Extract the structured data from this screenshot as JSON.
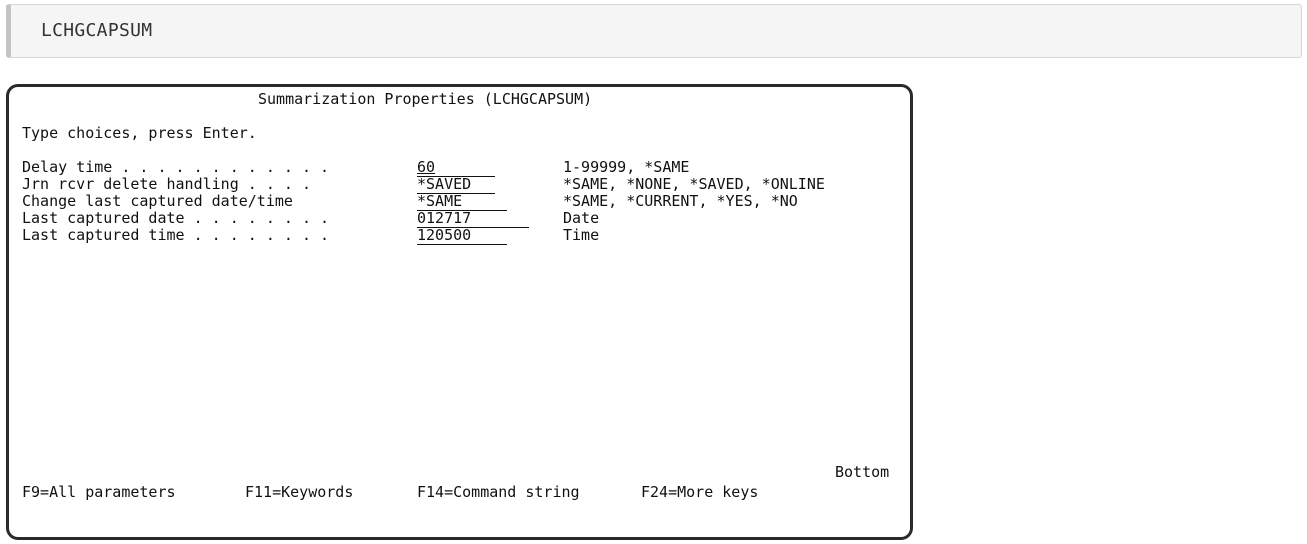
{
  "command_bar": {
    "text": "LCHGCAPSUM"
  },
  "screen": {
    "title": "Summarization Properties (LCHGCAPSUM)",
    "instruction": "Type choices, press Enter.",
    "rows": [
      {
        "label": "Delay time . . . . . . . . . . . .",
        "value": "60",
        "hint": "1-99999, *SAME"
      },
      {
        "label": "Jrn rcvr delete handling . . . .",
        "value": "*SAVED",
        "hint": "*SAME, *NONE, *SAVED, *ONLINE"
      },
      {
        "label": "Change last captured date/time",
        "value": "*SAME",
        "hint": "*SAME, *CURRENT, *YES, *NO"
      },
      {
        "label": "Last captured date . . . . . . . .",
        "value": "012717",
        "hint": "Date"
      },
      {
        "label": "Last captured time . . . . . . . .",
        "value": "120500",
        "hint": "Time"
      }
    ],
    "status": "Bottom",
    "function_keys": [
      "F9=All parameters",
      "F11=Keywords",
      "F14=Command string",
      "F24=More keys"
    ]
  }
}
